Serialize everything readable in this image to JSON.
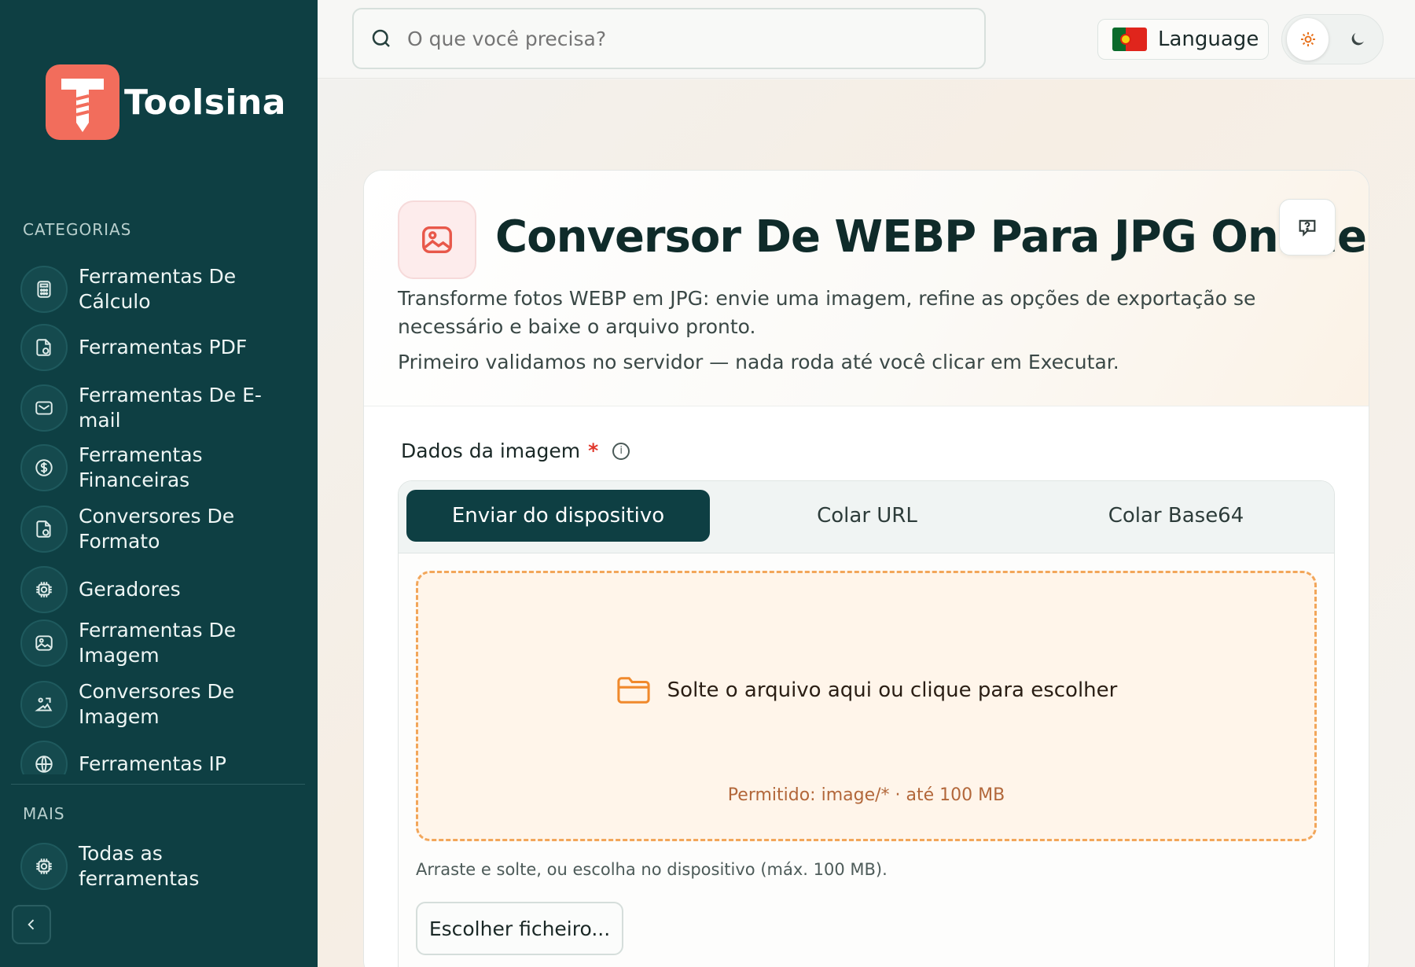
{
  "brand": {
    "name": "Toolsina"
  },
  "sidebar": {
    "categories_heading": "CATEGORIAS",
    "categories": [
      {
        "label": "Ferramentas De Cálculo",
        "icon": "calculator-icon"
      },
      {
        "label": "Ferramentas PDF",
        "icon": "file-icon"
      },
      {
        "label": "Ferramentas De E-mail",
        "icon": "mail-icon"
      },
      {
        "label": "Ferramentas Financeiras",
        "icon": "dollar-icon"
      },
      {
        "label": "Conversores De Formato",
        "icon": "file-convert-icon"
      },
      {
        "label": "Geradores",
        "icon": "cpu-icon"
      },
      {
        "label": "Ferramentas De Imagem",
        "icon": "image-icon"
      },
      {
        "label": "Conversores De Imagem",
        "icon": "image-convert-icon"
      },
      {
        "label": "Ferramentas IP",
        "icon": "globe-icon"
      }
    ],
    "more_heading": "MAIS",
    "more_items": [
      {
        "label": "Todas as ferramentas",
        "icon": "cpu-icon"
      }
    ]
  },
  "topbar": {
    "search_placeholder": "O que você precisa?",
    "language_label": "Language",
    "theme": {
      "active": "light"
    }
  },
  "tool": {
    "title": "Conversor De WEBP Para JPG Online",
    "description": "Transforme fotos WEBP em JPG: envie uma imagem, refine as opções de exportação se necessário e baixe o arquivo pronto.",
    "note": "Primeiro validamos no servidor — nada roda até você clicar em Executar."
  },
  "form": {
    "field_label": "Dados da imagem",
    "required_mark": "*",
    "tabs": [
      {
        "label": "Enviar do dispositivo",
        "active": true
      },
      {
        "label": "Colar URL",
        "active": false
      },
      {
        "label": "Colar Base64",
        "active": false
      }
    ],
    "dropzone_text": "Solte o arquivo aqui ou clique para escolher",
    "dropzone_hint": "Permitido: image/* · até 100 MB",
    "helper_text": "Arraste e solte, ou escolha no dispositivo (máx. 100 MB).",
    "choose_button": "Escolher ficheiro..."
  },
  "colors": {
    "sidebar_bg": "#0e3f43",
    "brand_accent": "#f26d5c",
    "dropzone_border": "#f2a65a",
    "dropzone_bg": "#fff5ea"
  }
}
